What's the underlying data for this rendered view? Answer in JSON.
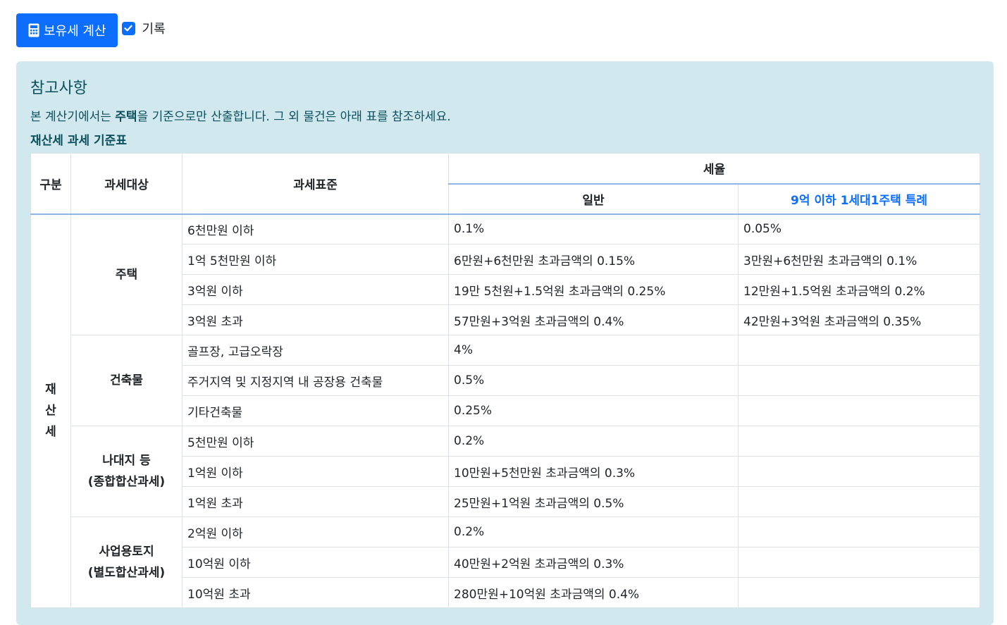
{
  "toolbar": {
    "calc_button_label": "보유세 계산",
    "record_checkbox_label": "기록",
    "record_checked": true
  },
  "notice": {
    "title": "참고사항",
    "desc_before": "본 계산기에서는 ",
    "desc_bold": "주택",
    "desc_after": "을 기준으로만 산출합니다. 그 외 물건은 아래 표를 참조하세요.",
    "table_caption": "재산세 과세 기준표"
  },
  "table": {
    "headers": {
      "division": "구분",
      "target": "과세대상",
      "standard": "과세표준",
      "rate": "세율",
      "general": "일반",
      "special": "9억 이하 1세대1주택 특례"
    },
    "group_label": [
      "재",
      "산",
      "세"
    ],
    "categories": [
      {
        "name_lines": [
          "주택"
        ],
        "rows": [
          {
            "standard": "6천만원 이하",
            "general": "0.1%",
            "special": "0.05%"
          },
          {
            "standard": "1억 5천만원 이하",
            "general": "6만원+6천만원 초과금액의 0.15%",
            "special": "3만원+6천만원 초과금액의 0.1%"
          },
          {
            "standard": "3억원 이하",
            "general": "19만 5천원+1.5억원 초과금액의 0.25%",
            "special": "12만원+1.5억원 초과금액의 0.2%"
          },
          {
            "standard": "3억원 초과",
            "general": "57만원+3억원 초과금액의 0.4%",
            "special": "42만원+3억원 초과금액의 0.35%"
          }
        ]
      },
      {
        "name_lines": [
          "건축물"
        ],
        "rows": [
          {
            "standard": "골프장, 고급오락장",
            "general": "4%",
            "special": ""
          },
          {
            "standard": "주거지역 및 지정지역 내 공장용 건축물",
            "general": "0.5%",
            "special": ""
          },
          {
            "standard": "기타건축물",
            "general": "0.25%",
            "special": ""
          }
        ]
      },
      {
        "name_lines": [
          "나대지 등",
          "(종합합산과세)"
        ],
        "rows": [
          {
            "standard": "5천만원 이하",
            "general": "0.2%",
            "special": ""
          },
          {
            "standard": "1억원 이하",
            "general": "10만원+5천만원 초과금액의 0.3%",
            "special": ""
          },
          {
            "standard": "1억원 초과",
            "general": "25만원+1억원 초과금액의 0.5%",
            "special": ""
          }
        ]
      },
      {
        "name_lines": [
          "사업용토지",
          "(별도합산과세)"
        ],
        "rows": [
          {
            "standard": "2억원 이하",
            "general": "0.2%",
            "special": ""
          },
          {
            "standard": "10억원 이하",
            "general": "40만원+2억원 초과금액의 0.3%",
            "special": ""
          },
          {
            "standard": "10억원 초과",
            "general": "280만원+10억원 초과금액의 0.4%",
            "special": ""
          }
        ]
      }
    ]
  },
  "colors": {
    "primary": "#0d6efd",
    "alert_bg": "#d1e9ee",
    "alert_text": "#0b4f5c"
  }
}
